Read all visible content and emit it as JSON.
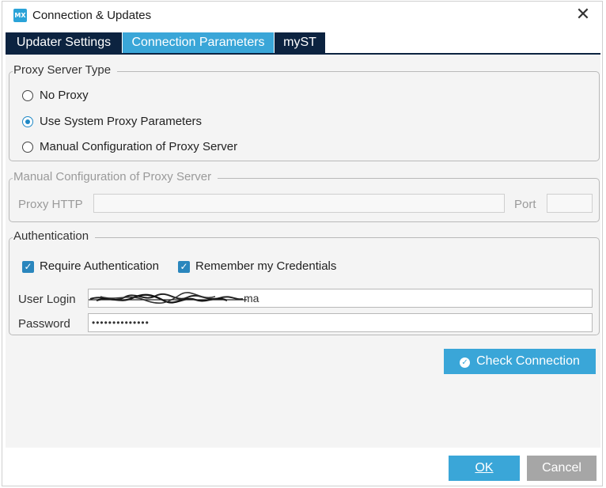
{
  "window": {
    "title": "Connection & Updates",
    "app_icon_text": "MX",
    "close_symbol": "✕"
  },
  "tabs": [
    {
      "label": "Updater Settings",
      "active": false
    },
    {
      "label": "Connection Parameters",
      "active": true
    },
    {
      "label": "myST",
      "active": false
    }
  ],
  "proxy_server_type": {
    "legend": "Proxy Server Type",
    "options": [
      {
        "label": "No Proxy",
        "selected": false
      },
      {
        "label": "Use System Proxy Parameters",
        "selected": true
      },
      {
        "label": "Manual Configuration of Proxy Server",
        "selected": false
      }
    ]
  },
  "manual_config": {
    "legend": "Manual Configuration of Proxy Server",
    "proxy_http_label": "Proxy HTTP",
    "proxy_http_value": "",
    "port_label": "Port",
    "port_value": ""
  },
  "authentication": {
    "legend": "Authentication",
    "require_auth_label": "Require Authentication",
    "require_auth_checked": true,
    "remember_label": "Remember my Credentials",
    "remember_checked": true,
    "user_login_label": "User Login",
    "user_login_visible_suffix": "ma",
    "password_label": "Password",
    "password_value": "••••••••••••••"
  },
  "check_connection_label": "Check Connection",
  "footer": {
    "ok_label": "OK",
    "cancel_label": "Cancel"
  },
  "colors": {
    "tab_dark": "#0c2340",
    "accent": "#3aa6d8",
    "cancel_gray": "#a6a6a6"
  }
}
